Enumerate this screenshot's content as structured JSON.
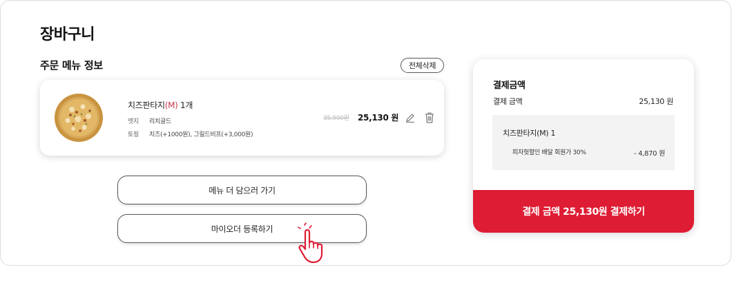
{
  "page": {
    "title": "장바구니"
  },
  "order": {
    "section_title": "주문 메뉴 정보",
    "delete_all_label": "전체삭제",
    "item": {
      "name": "치즈판타지",
      "size": "(M)",
      "quantity": "1개",
      "options": [
        {
          "label": "엣지",
          "value": "리치골드"
        },
        {
          "label": "토핑",
          "value": "치즈(+1000원), 그릴드비프(+3,000원)"
        }
      ],
      "original_price": "35,900원",
      "price": "25,130 원",
      "edit_icon": "pencil-icon",
      "delete_icon": "trash-icon"
    },
    "more_menu_label": "메뉴 더 담으러 가기",
    "register_label": "마이오더 등록하기"
  },
  "payment": {
    "title": "결제금액",
    "amount_label": "결제 금액",
    "amount_value": "25,130 원",
    "detail_item": "치즈판타지(M) 1",
    "discount_label": "피자헛할인 배달 회원가 30%",
    "discount_value": "- 4,870 원",
    "pay_button_label": "결제 금액 25,130원 결제하기"
  },
  "colors": {
    "accent": "#de1c33",
    "size_text": "#c8384a"
  }
}
